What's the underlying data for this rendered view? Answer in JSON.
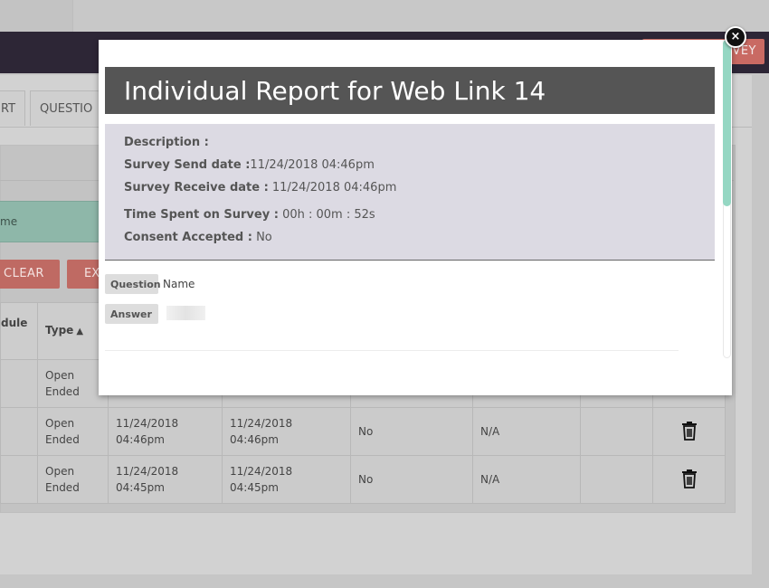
{
  "header": {
    "survey_button_label": "VEY"
  },
  "tabs": [
    {
      "label": "RT"
    },
    {
      "label": "QUESTIO"
    }
  ],
  "filters": {
    "name_fragment": "me",
    "clear_label": "CLEAR",
    "export_label": "EX"
  },
  "table": {
    "headers": {
      "schedule": "dule",
      "type": "Type"
    },
    "rows": [
      {
        "type": "Open\nEnded",
        "send_date": "",
        "receive_date": "",
        "consent": "",
        "time": ""
      },
      {
        "type": "Open\nEnded",
        "send_date": "11/24/2018\n04:46pm",
        "receive_date": "11/24/2018 04:46pm",
        "consent": "No",
        "time": "N/A"
      },
      {
        "type": "Open\nEnded",
        "send_date": "11/24/2018\n04:45pm",
        "receive_date": "11/24/2018 04:45pm",
        "consent": "No",
        "time": "N/A"
      }
    ]
  },
  "modal": {
    "title": "Individual Report for Web Link 14",
    "description_label": "Description :",
    "description_value": "",
    "send_label": "Survey Send date :",
    "send_value": "11/24/2018 04:46pm",
    "receive_label": "Survey Receive date :",
    "receive_value": " 11/24/2018 04:46pm",
    "time_label": "Time Spent on Survey :",
    "time_value": " 00h : 00m : 52s",
    "consent_label": "Consent Accepted :",
    "consent_value": " No",
    "question_label": "Question",
    "question_text": "Name",
    "answer_label": "Answer",
    "close_icon": "close-icon"
  },
  "colors": {
    "navbar": "#2d2636",
    "accent_red": "#c96a63",
    "modal_title_bg": "#555555",
    "info_bg": "#dcdae3",
    "scroll_thumb": "#95d7c3"
  }
}
